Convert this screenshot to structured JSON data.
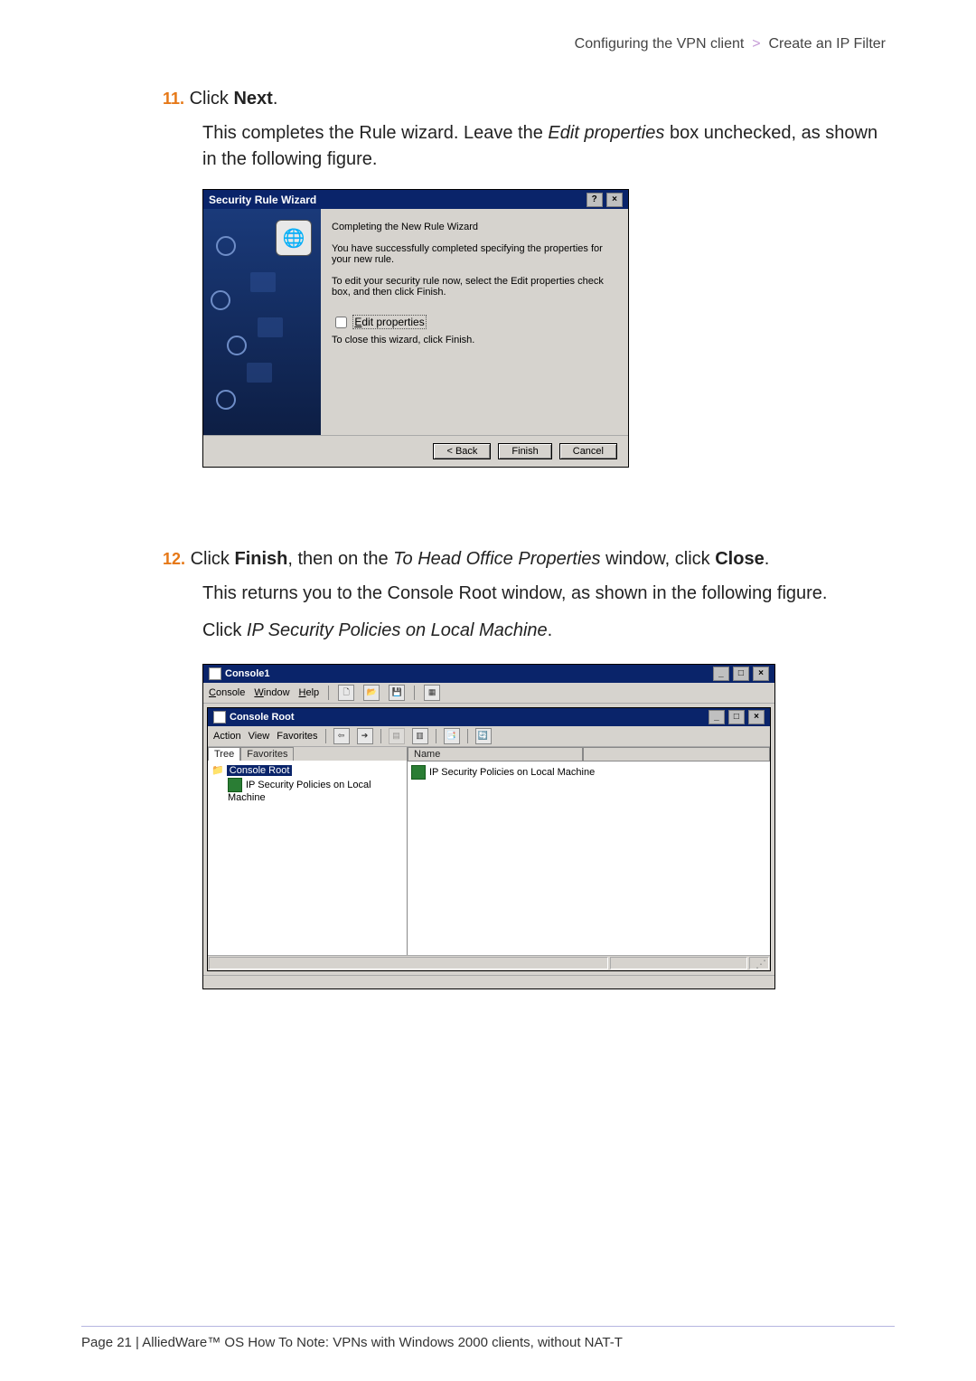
{
  "breadcrumb": {
    "section": "Configuring the VPN client",
    "sep": ">",
    "page": "Create an IP Filter"
  },
  "step11": {
    "num": "11.",
    "lead": "Click ",
    "bold": "Next",
    "tail": ".",
    "para_a": "This completes the Rule wizard. Leave the ",
    "para_b": "Edit properties",
    "para_c": " box unchecked, as shown in the following figure."
  },
  "wizard": {
    "title": "Security Rule Wizard",
    "help_icon": "?",
    "close_icon": "×",
    "heading": "Completing the New Rule Wizard",
    "line1": "You have successfully completed specifying the properties for your new rule.",
    "line2": "To edit your security rule now, select the Edit properties check box, and then click Finish.",
    "editprop_label": "Edit properties",
    "closeline": "To close this wizard, click Finish.",
    "btn_back": "< Back",
    "btn_finish": "Finish",
    "btn_cancel": "Cancel"
  },
  "step12": {
    "num": "12.",
    "a": "Click ",
    "b": "Finish",
    "c": ", then on the ",
    "d": "To Head Office Properties",
    "e": " window, click ",
    "f": "Close",
    "g": ".",
    "para1": "This returns you to the Console Root window, as shown in the following figure.",
    "para2a": "Click ",
    "para2b": "IP Security Policies on Local Machine",
    "para2c": "."
  },
  "console": {
    "title": "Console1",
    "min_icon": "_",
    "max_icon": "□",
    "close_icon": "×",
    "menu_console": "Console",
    "menu_window": "Window",
    "menu_help": "Help",
    "sub_title": "Console Root",
    "menu_action": "Action",
    "menu_view": "View",
    "menu_favorites": "Favorites",
    "tab_tree": "Tree",
    "tab_fav": "Favorites",
    "tree_root": "Console Root",
    "tree_child": "IP Security Policies on Local Machine",
    "col_name": "Name",
    "list_item": "IP Security Policies on Local Machine"
  },
  "footer": {
    "text": "Page 21 | AlliedWare™ OS How To Note: VPNs with Windows 2000 clients, without NAT-T"
  }
}
